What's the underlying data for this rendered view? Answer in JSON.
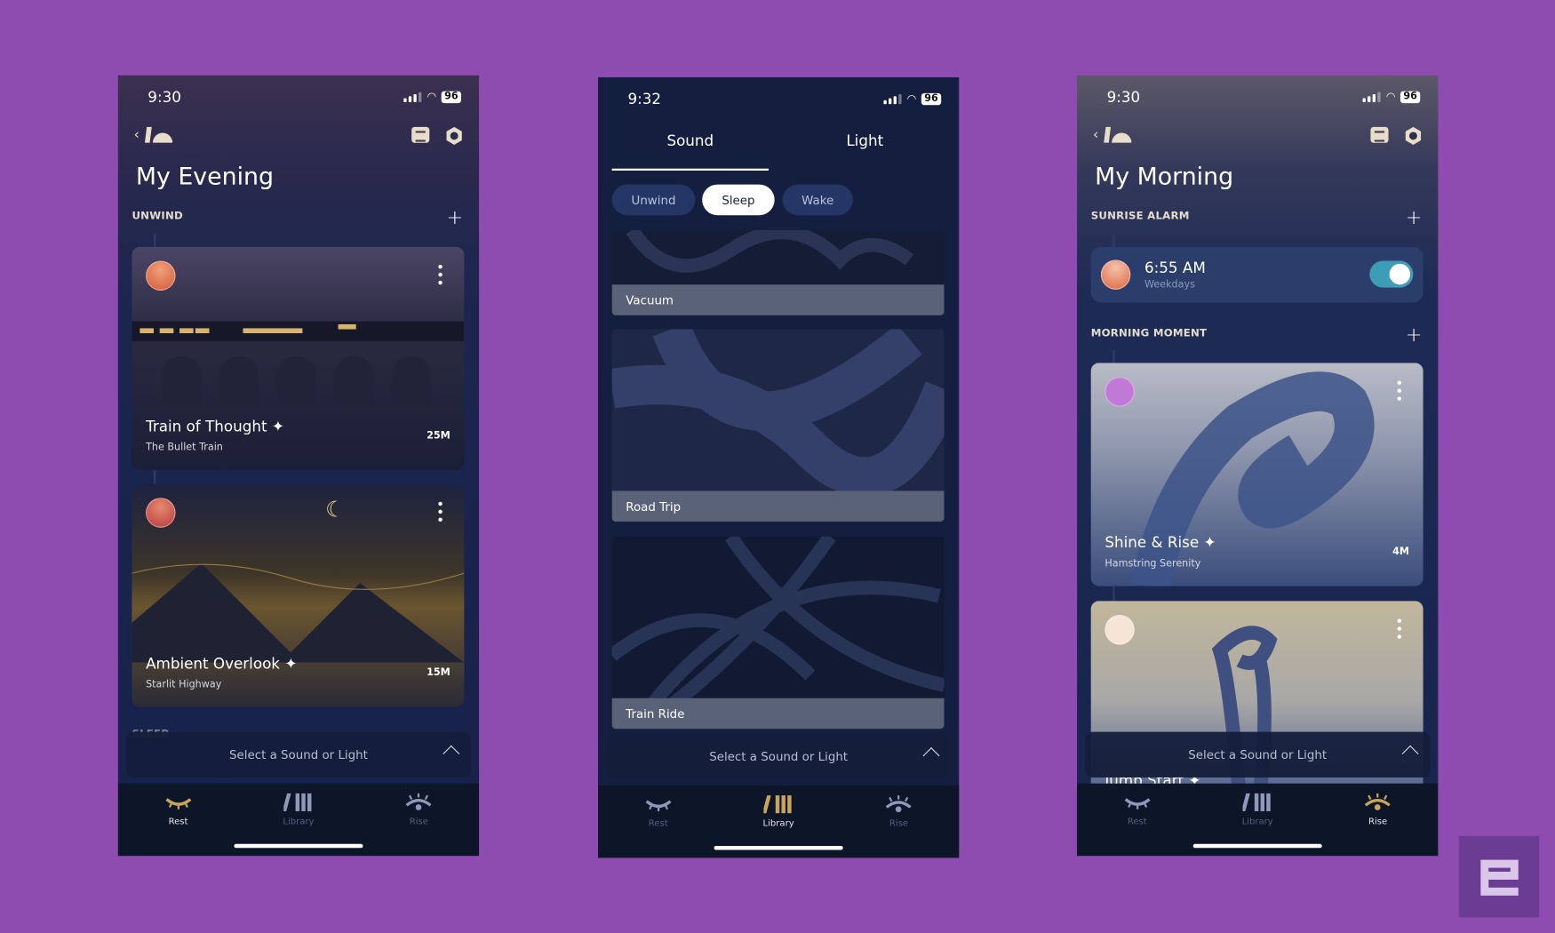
{
  "colors": {
    "background": "#8e4cb0",
    "accent_toggle": "#3e9db6",
    "tab_active": "#e6e6ea"
  },
  "phones": [
    {
      "time": "9:30",
      "battery": "96",
      "title": "My Evening",
      "section": "UNWIND",
      "section2_partial": "SLEEP",
      "cards": [
        {
          "title": "Train of Thought",
          "subtitle": "The Bullet Train",
          "duration": "25M"
        },
        {
          "title": "Ambient Overlook",
          "subtitle": "Starlit Highway",
          "duration": "15M"
        }
      ],
      "sheet": "Select a Sound or Light",
      "active_tab": "Rest"
    },
    {
      "time": "9:32",
      "battery": "96",
      "segments": [
        "Sound",
        "Light"
      ],
      "active_segment": "Sound",
      "chips": [
        "Unwind",
        "Sleep",
        "Wake"
      ],
      "active_chip": "Sleep",
      "sounds": [
        "Vacuum",
        "Road Trip",
        "Train Ride"
      ],
      "sheet": "Select a Sound or Light",
      "active_tab": "Library"
    },
    {
      "time": "9:30",
      "battery": "96",
      "title": "My Morning",
      "section": "SUNRISE ALARM",
      "alarm": {
        "time": "6:55 AM",
        "days": "Weekdays",
        "enabled": true
      },
      "section2": "MORNING MOMENT",
      "cards": [
        {
          "title": "Shine & Rise",
          "subtitle": "Hamstring Serenity",
          "duration": "4M"
        },
        {
          "title": "Jump Start"
        }
      ],
      "sheet": "Select a Sound or Light",
      "active_tab": "Rise"
    }
  ],
  "tabs": [
    "Rest",
    "Library",
    "Rise"
  ]
}
